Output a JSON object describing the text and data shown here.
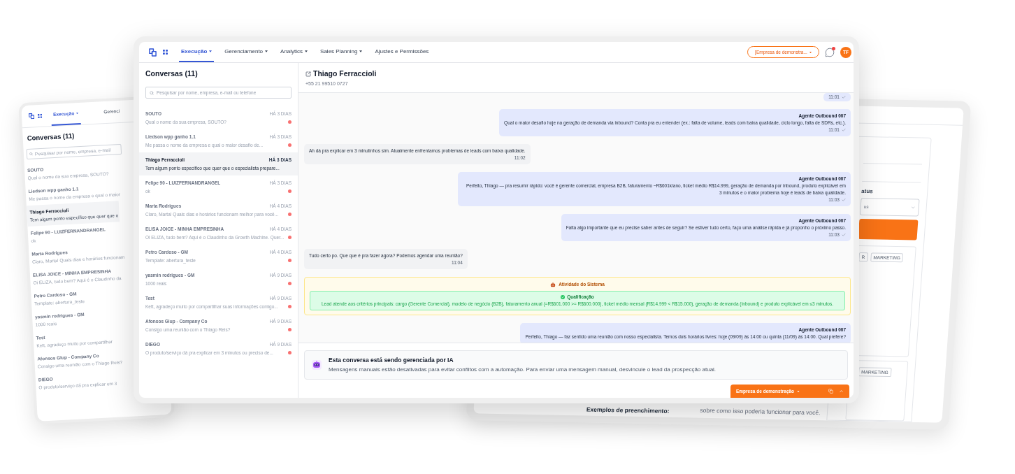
{
  "background_left_device": {
    "nav": [
      {
        "label": "Execução",
        "selected": true,
        "has_caret": true
      },
      {
        "label": "Gerenci",
        "selected": false,
        "has_caret": false
      }
    ],
    "title": "Conversas (11)",
    "search": {
      "placeholder": "Pesquisar por nome, empresa, e-mail"
    },
    "conversations": [
      {
        "name": "SOUTO",
        "preview": "Qual o nome da sua empresa, SOUTO?",
        "selected": false
      },
      {
        "name": "Liedson wpp ganho 1.1",
        "preview": "Me passa o nome da empresa e qual o maior",
        "selected": false
      },
      {
        "name": "Thiago Ferraccioli",
        "preview": "Tem algum ponto específico que quer que o",
        "selected": true
      },
      {
        "name": "Felipe 90 - LUIZFERNANDRANGEL",
        "preview": "ok",
        "selected": false
      },
      {
        "name": "Marta Rodrigues",
        "preview": "Claro, Marta! Quais dias e horários funcionam",
        "selected": false
      },
      {
        "name": "ELISA JOICE - MINHA EMPRESINHA",
        "preview": "Oi ELIZA, tudo bem? Aqui é o Claudinho da",
        "selected": false
      },
      {
        "name": "Petro Cardoso - GM",
        "preview": "Template: abertura_teste",
        "selected": false
      },
      {
        "name": "yasmin rodrigues - GM",
        "preview": "1000 reais",
        "selected": false
      },
      {
        "name": "Test",
        "preview": "Kett, agradeço muito por compartilhar",
        "selected": false
      },
      {
        "name": "Afonsos Glup - Company Co",
        "preview": "Consigo uma reunião com o Thiago Reis?",
        "selected": false
      },
      {
        "name": "DIEGO",
        "preview": "O produto/serviço dá pra explicar em 3",
        "selected": false
      }
    ]
  },
  "background_right_device": {
    "status_label": "atus",
    "status_select": {
      "value": "us"
    },
    "cards": [
      {
        "tags": [
          "R",
          "MARKETING"
        ]
      },
      {
        "tags": [
          "MARKETING"
        ]
      }
    ],
    "examples_label": "Exemplos de preenchimento:",
    "example_text": "sobre como isso poderia funcionar para você."
  },
  "main": {
    "nav": {
      "items": [
        {
          "label": "Execução",
          "selected": true,
          "has_caret": true
        },
        {
          "label": "Gerenciamento",
          "selected": false,
          "has_caret": true
        },
        {
          "label": "Analytics",
          "selected": false,
          "has_caret": true
        },
        {
          "label": "Sales Planning",
          "selected": false,
          "has_caret": true
        },
        {
          "label": "Ajustes e Permissões",
          "selected": false,
          "has_caret": false
        }
      ],
      "company_selector": "[Empresa de demonstra...",
      "notifications": {
        "unread": true
      },
      "avatar_initials": "TF"
    },
    "conversations": {
      "title": "Conversas (11)",
      "search": {
        "placeholder": "Pesquisar por nome, empresa, e-mail ou telefone"
      },
      "items": [
        {
          "name": "SOUTO",
          "time": "HÁ 3 DIAS",
          "preview": "Qual o nome da sua empresa, SOUTO?",
          "selected": false,
          "unread": true
        },
        {
          "name": "Liedson wpp ganho 1.1",
          "time": "HÁ 3 DIAS",
          "preview": "Me passa o nome da empresa e qual o maior desafio de...",
          "selected": false,
          "unread": true
        },
        {
          "name": "Thiago Ferraccioli",
          "time": "HÁ 3 DIAS",
          "preview": "Tem algum ponto específico que quer que o especialista prepare...",
          "selected": true,
          "unread": false
        },
        {
          "name": "Felipe 90 - LUIZFERNANDRANGEL",
          "time": "HÁ 3 DIAS",
          "preview": "ok",
          "selected": false,
          "unread": true
        },
        {
          "name": "Marta Rodrigues",
          "time": "HÁ 4 DIAS",
          "preview": "Claro, Marta! Quais dias e horários funcionam melhor para você...",
          "selected": false,
          "unread": true
        },
        {
          "name": "ELISA JOICE - MINHA EMPRESINHA",
          "time": "HÁ 4 DIAS",
          "preview": "Oi ELIZA, tudo bem? Aqui é o Claudinho da Growth Machine. Quer...",
          "selected": false,
          "unread": true
        },
        {
          "name": "Petro Cardoso - GM",
          "time": "HÁ 4 DIAS",
          "preview": "Template: abertura_teste",
          "selected": false,
          "unread": true
        },
        {
          "name": "yasmin rodrigues - GM",
          "time": "HÁ 9 DIAS",
          "preview": "1000 reais",
          "selected": false,
          "unread": true
        },
        {
          "name": "Test",
          "time": "HÁ 9 DIAS",
          "preview": "Kett, agradeço muito por compartilhar suas informações comigo...",
          "selected": false,
          "unread": true
        },
        {
          "name": "Afonsos Glup - Company Co",
          "time": "HÁ 9 DIAS",
          "preview": "Consigo uma reunião com o Thiago Reis?",
          "selected": false,
          "unread": true
        },
        {
          "name": "DIEGO",
          "time": "HÁ 9 DIAS",
          "preview": "O produto/serviço dá pra explicar em 3 minutos ou preciso de...",
          "selected": false,
          "unread": true
        }
      ]
    },
    "chat": {
      "contact": {
        "name": "Thiago Ferraccioli",
        "phone": "+55 21 99510 0727"
      },
      "messages": [
        {
          "kind": "outgoing",
          "time": "11:01"
        },
        {
          "kind": "outgoing",
          "sender": "Agente Outbound 007",
          "text": "Qual o maior desafio hoje na geração de demanda via inbound? Conta pra eu entender (ex.: falta de volume, leads com baixa qualidade, ciclo longo, falta de SDRs, etc.).",
          "time": "11:01"
        },
        {
          "kind": "incoming",
          "text": "Ah dá pra explicar em 3 minutinhos sim. Atualmente enfrentamos problemas de leads com baixa qualidade.",
          "time": "11:02"
        },
        {
          "kind": "outgoing",
          "sender": "Agente Outbound 007",
          "text": "Perfeito, Thiago — pra resumir rápido: você é gerente comercial, empresa B2B, faturamento ~R$601k/ano, ticket médio R$14.999, geração de demanda por inbound, produto explicável em 3 minutos e o maior problema hoje é leads de baixa qualidade.",
          "time": "11:03"
        },
        {
          "kind": "outgoing",
          "sender": "Agente Outbound 007",
          "text": "Falta algo importante que eu precise saber antes de seguir? Se estiver tudo certo, faço uma análise rápida e já proponho o próximo passo.",
          "time": "11:03"
        },
        {
          "kind": "incoming",
          "text": "Tudo certo po. Que que é pra fazer agora? Podemos agendar uma reunião?",
          "time": "11:04"
        },
        {
          "kind": "system",
          "title": "Atividade do Sistema",
          "event": {
            "title": "Qualificação",
            "text": "Lead atende aos critérios principais: cargo (Gerente Comercial), modelo de negócio (B2B), faturamento anual (=R$601.000 >= R$600.000), ticket médio mensal (R$14.999 < R$15.000), geração de demanda (Inbound) e produto explicável em ≤3 minutos."
          }
        },
        {
          "kind": "outgoing",
          "sender": "Agente Outbound 007",
          "text": "Perfeito, Thiago — faz sentido uma reunião com nosso especialista. Temos dois horários livres: hoje (09/09) às 14:00 ou quinta (11/09) às 14:00. Qual prefere?"
        }
      ],
      "ai_notice": {
        "title": "Esta conversa está sendo gerenciada por IA",
        "body": "Mensagens manuais estão desativadas para evitar conflitos com a automação. Para enviar uma mensagem manual, desvincule o lead da prospecção atual."
      }
    },
    "company_bar": {
      "label": "Empresa de demonstração"
    }
  }
}
